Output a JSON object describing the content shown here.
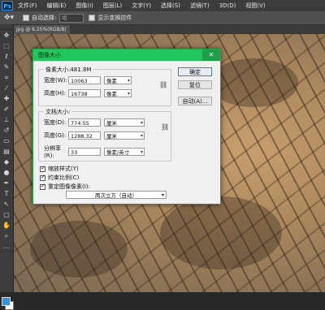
{
  "app": {
    "logo": "Ps",
    "menu": [
      "文件(F)",
      "编辑(E)",
      "图像(I)",
      "图层(L)",
      "文字(Y)",
      "选择(S)",
      "滤镜(T)",
      "3D(D)",
      "视图(V)"
    ]
  },
  "options_bar": {
    "auto_select_label": "自动选择:",
    "auto_select_value": "组",
    "transform_label": "显示变换控件"
  },
  "document_tab": {
    "title": "jpg @ 6.25%(RGB/8)"
  },
  "dialog": {
    "title": "图像大小",
    "close_glyph": "✕",
    "pixel_dimensions": "像素大小:481.8M",
    "pixel": {
      "width_label": "宽度(W):",
      "width_value": "10063",
      "width_unit": "像素",
      "height_label": "高度(H):",
      "height_value": "16738",
      "height_unit": "像素"
    },
    "document_size": {
      "legend": "文档大小:",
      "width_label": "宽度(D):",
      "width_value": "774.55",
      "width_unit": "厘米",
      "height_label": "高度(G):",
      "height_value": "1288.32",
      "height_unit": "厘米",
      "resolution_label": "分辨率(R):",
      "resolution_value": "33",
      "resolution_unit": "像素/英寸"
    },
    "buttons": {
      "ok": "确定",
      "reset": "复位",
      "auto": "自动(A)..."
    },
    "options": {
      "scale_styles": "缩放样式(Y)",
      "constrain": "约束比例(C)",
      "resample": "重定图像像素(I):",
      "resample_method": "两次立方（自动）"
    }
  },
  "colors": {
    "foreground": "#2b95e0",
    "background": "#ffffff",
    "dialog_title_bar": "#22c55e"
  }
}
